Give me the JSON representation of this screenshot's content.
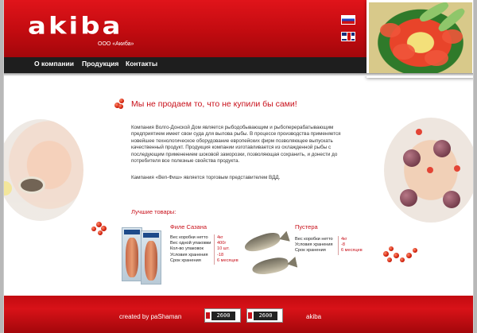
{
  "brand": {
    "logo_text": "akiba",
    "company_line": "ООО «Акиба»"
  },
  "nav": {
    "items": [
      "О компании",
      "Продукция",
      "Контакты"
    ]
  },
  "languages": [
    "ru-flag",
    "en-flag"
  ],
  "main": {
    "headline": "Мы не продаем то, что не купили бы сами!",
    "paragraph1": "Компания Волго-Донской Дом является рыбодобывающим и рыбоперерабатывающим предприятием имеет свои суда для вылова рыбы. В процессе производства применяется новейшее технологическое оборудование европейских фирм позволяющее выпускать качественный продукт. Продукция компании изготавливается из охлажденной рыбы с последующим применением шоковой заморозки, позволяющая сохранить, и донести до потребителя все полезные свойства продукта.",
    "paragraph2": "Кампания «Веп-Фиш» является торговым представителем ВДД.",
    "best_label": "Лучшие товары:"
  },
  "products": [
    {
      "name": "Филе Сазана",
      "specs": [
        "Вес коробки нетто",
        "Вес одной упаковки",
        "Кол-во упаковок",
        "Условия хранения",
        "Срок хранения"
      ],
      "values": [
        "4кг",
        "400г",
        "10 шт.",
        "-18",
        "6 месяцев"
      ]
    },
    {
      "name": "Пустера",
      "specs": [
        "Вес коробки нетто",
        "Условия хранения",
        "Срок хранения"
      ],
      "values": [
        "4кг",
        "-8",
        "6 месяцев"
      ]
    }
  ],
  "footer": {
    "created_by": "created by paShaman",
    "counter1": "2600",
    "counter2": "2600",
    "brand": "akiba"
  },
  "colors": {
    "accent": "#c8101a",
    "header_red": "#d81218",
    "nav_bg": "#1e1e1e"
  }
}
